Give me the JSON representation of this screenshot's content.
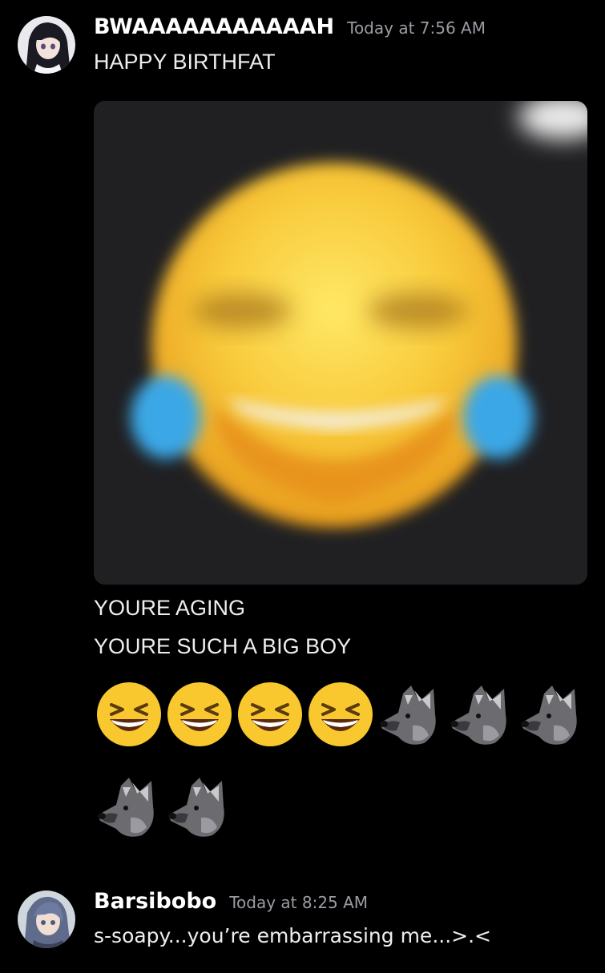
{
  "messages": [
    {
      "username": "BWAAAAAAAAAAAH",
      "timestamp": "Today at 7:56 AM",
      "avatar_icon": "anime-girl-avatar",
      "lines_before": [
        "HAPPY BIRTHFAT"
      ],
      "attachment_icon": "face-with-tears-of-joy-blurred-image",
      "lines_after": [
        "YOURE AGING",
        "YOURE SUCH A BIG BOY"
      ],
      "emoji_rows": [
        [
          "grinning-squinting-face",
          "grinning-squinting-face",
          "grinning-squinting-face",
          "grinning-squinting-face",
          "wolf-face",
          "wolf-face",
          "wolf-face"
        ],
        [
          "wolf-face",
          "wolf-face"
        ]
      ]
    },
    {
      "username": "Barsibobo",
      "timestamp": "Today at 8:25 AM",
      "avatar_icon": "anime-boy-avatar",
      "lines_before": [
        "s-soapy...you’re embarrassing me...>.<"
      ]
    }
  ],
  "colors": {
    "background": "#000000",
    "username": "#ffffff",
    "timestamp": "#9b9ca3",
    "message_text": "#eeeeee"
  }
}
